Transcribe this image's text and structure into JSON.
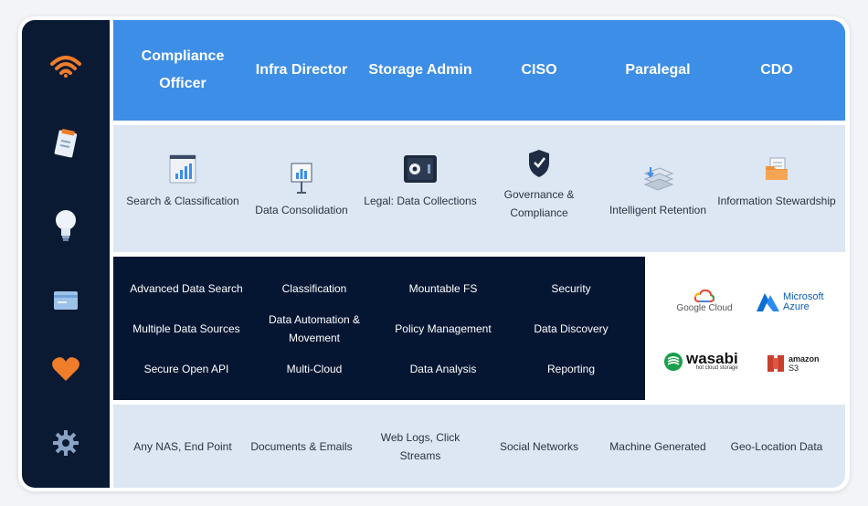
{
  "roles": [
    "Compliance Officer",
    "Infra Director",
    "Storage Admin",
    "CISO",
    "Paralegal",
    "CDO"
  ],
  "capabilities": [
    {
      "label": "Search & Classification",
      "icon": "chart-screen-icon"
    },
    {
      "label": "Data Consolidation",
      "icon": "presentation-board-icon"
    },
    {
      "label": "Legal: Data Collections",
      "icon": "safe-icon"
    },
    {
      "label": "Governance & Compliance",
      "icon": "shield-check-icon"
    },
    {
      "label": "Intelligent Retention",
      "icon": "stacked-storage-icon"
    },
    {
      "label": "Information Stewardship",
      "icon": "folder-documents-icon"
    }
  ],
  "features": [
    [
      "Advanced Data Search",
      "Classification",
      "Mountable FS",
      "Security"
    ],
    [
      "Multiple Data Sources",
      "Data Automation & Movement",
      "Policy Management",
      "Data Discovery"
    ],
    [
      "Secure Open API",
      "Multi-Cloud",
      "Data Analysis",
      "Reporting"
    ]
  ],
  "clouds": {
    "google": "Google Cloud",
    "azure_line1": "Microsoft",
    "azure_line2": "Azure",
    "wasabi": "wasabi",
    "wasabi_sub": "hot cloud storage",
    "amazon": "amazon",
    "amazon_sub": "S3"
  },
  "sources": [
    "Any NAS, End Point",
    "Documents & Emails",
    "Web Logs, Click Streams",
    "Social Networks",
    "Machine Generated",
    "Geo-Location Data"
  ],
  "sidebar_icons": [
    "wifi-icon",
    "clipboard-icon",
    "lightbulb-icon",
    "card-icon",
    "heart-icon",
    "gear-icon"
  ],
  "colors": {
    "sidebar": "#0a1a33",
    "roles_band": "#3d8ee6",
    "light_band": "#dde7f3",
    "features_band": "#051633",
    "accent_orange": "#f07d2a"
  }
}
